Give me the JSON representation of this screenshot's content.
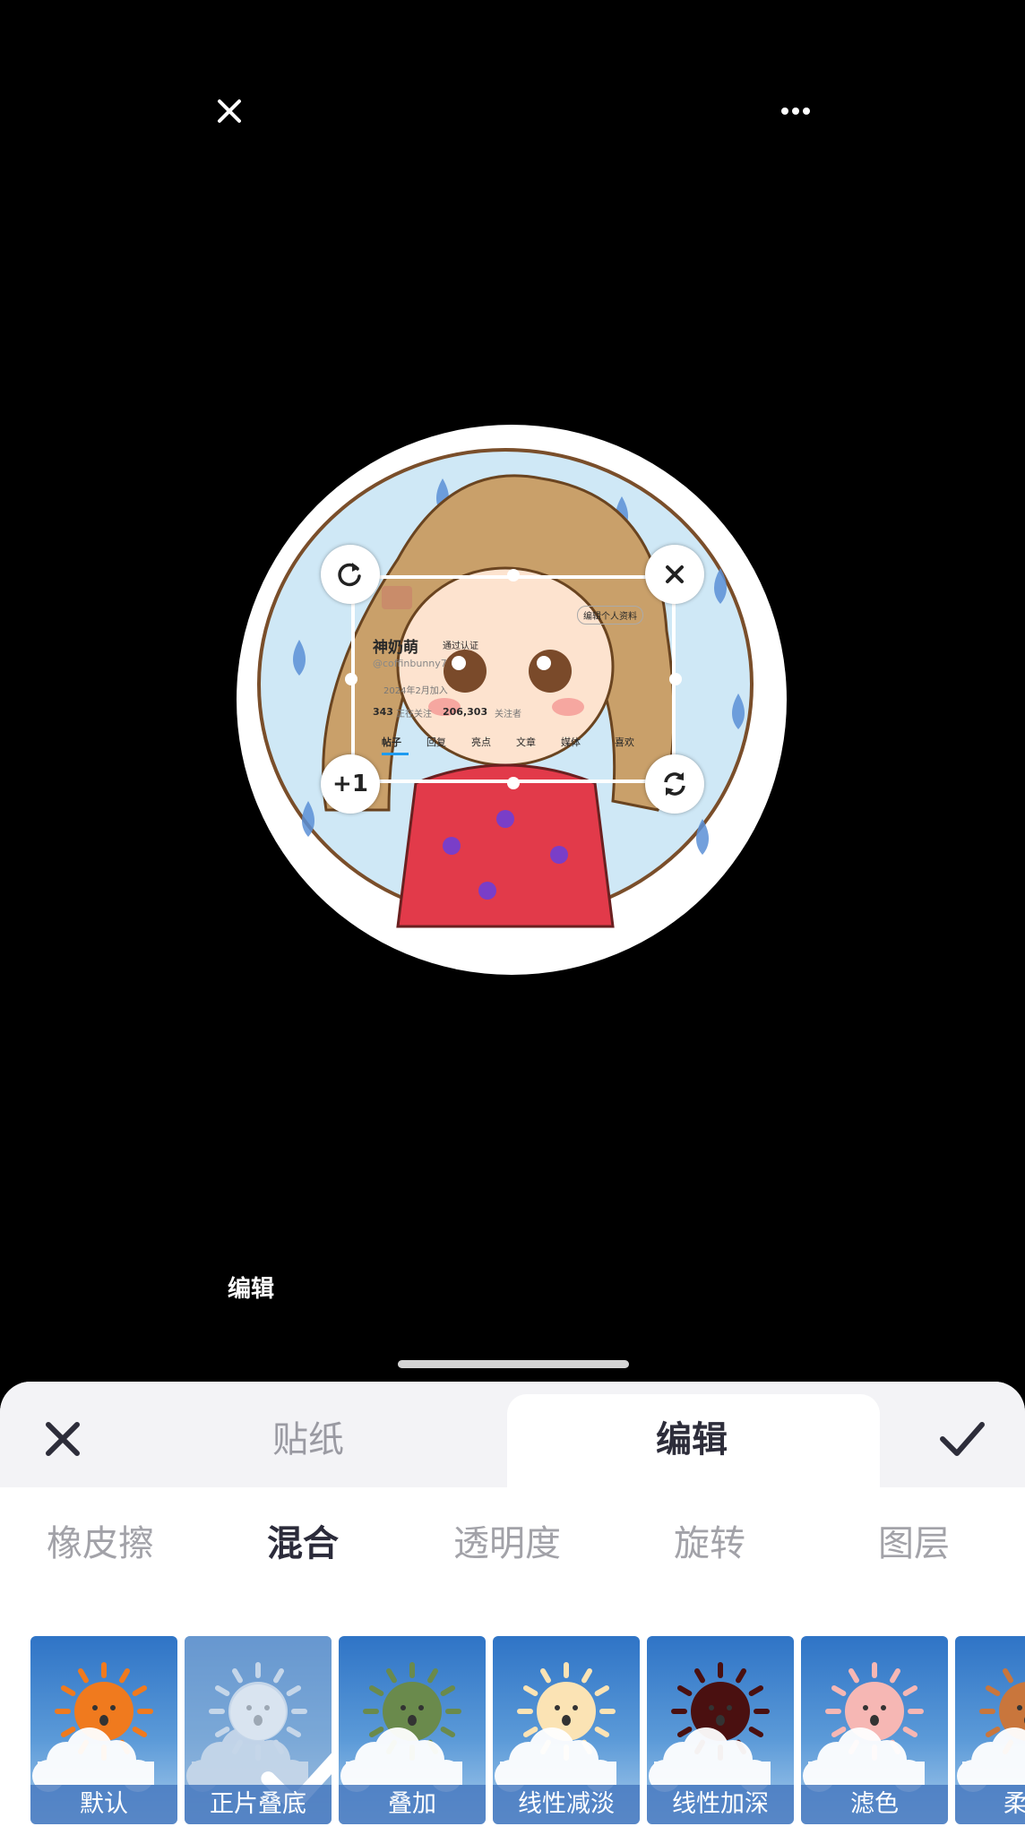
{
  "top_bar": {
    "close_icon": "close-icon",
    "more_icon": "more-icon"
  },
  "canvas": {
    "sticker": {
      "name": "神奶萌",
      "verified": "通过认证",
      "handle": "@coffinbunny7",
      "joined": "2024年2月加入",
      "following_count": "343",
      "following_label": "正在关注",
      "followers_count": "206,303",
      "followers_label": "关注者",
      "edit_profile": "编辑个人资料",
      "tabs": [
        "帖子",
        "回复",
        "亮点",
        "文章",
        "媒体",
        "喜欢"
      ]
    },
    "handles": {
      "rotate_icon": "rotate-icon",
      "delete_icon": "close-icon",
      "duplicate_label": "+1",
      "flip_icon": "flip-icon"
    }
  },
  "edit_caption": "编辑",
  "panel": {
    "tabs": {
      "sticker": "贴纸",
      "edit": "编辑"
    },
    "tools": [
      "橡皮擦",
      "混合",
      "透明度",
      "旋转",
      "图层"
    ],
    "active_tool": "混合",
    "blend_modes": [
      {
        "label": "默认",
        "sun": "#f07a1e"
      },
      {
        "label": "正片叠底",
        "sun": "#ffffff",
        "selected": true
      },
      {
        "label": "叠加",
        "sun": "#6a8a4c"
      },
      {
        "label": "线性减淡",
        "sun": "#fbe3b4"
      },
      {
        "label": "线性加深",
        "sun": "#4a1010"
      },
      {
        "label": "滤色",
        "sun": "#f6b7b4"
      },
      {
        "label": "柔",
        "sun": "#c9763c"
      }
    ]
  },
  "colors": {
    "accent": "#2d2d3a",
    "panel_bg": "#f3f3f6",
    "blend_label_bg": "#4678be"
  }
}
